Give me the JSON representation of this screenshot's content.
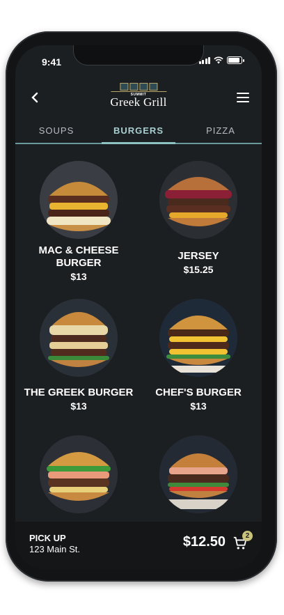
{
  "status_bar": {
    "time": "9:41",
    "battery_level": 0.9
  },
  "header": {
    "logo_top": "SUMMIT",
    "logo_name": "Greek Grill",
    "back_icon": "chevron-left-icon",
    "menu_icon": "hamburger-menu-icon"
  },
  "tabs": [
    {
      "label": "SOUPS",
      "active": false
    },
    {
      "label": "BURGERS",
      "active": true
    },
    {
      "label": "PIZZA",
      "active": false
    }
  ],
  "menu_items": [
    {
      "name": "MAC & CHEESE BURGER",
      "price": "$13"
    },
    {
      "name": "JERSEY",
      "price": "$15.25"
    },
    {
      "name": "THE GREEK BURGER",
      "price": "$13"
    },
    {
      "name": "CHEF'S BURGER",
      "price": "$13"
    },
    {
      "name": "",
      "price": ""
    },
    {
      "name": "",
      "price": ""
    }
  ],
  "footer": {
    "pickup_label": "PICK UP",
    "address": "123 Main St.",
    "total": "$12.50",
    "cart_count": "2",
    "cart_icon": "cart-icon"
  },
  "colors": {
    "accent": "#8ec3c4",
    "background": "#1c1f22",
    "badge": "#c9c27a"
  }
}
